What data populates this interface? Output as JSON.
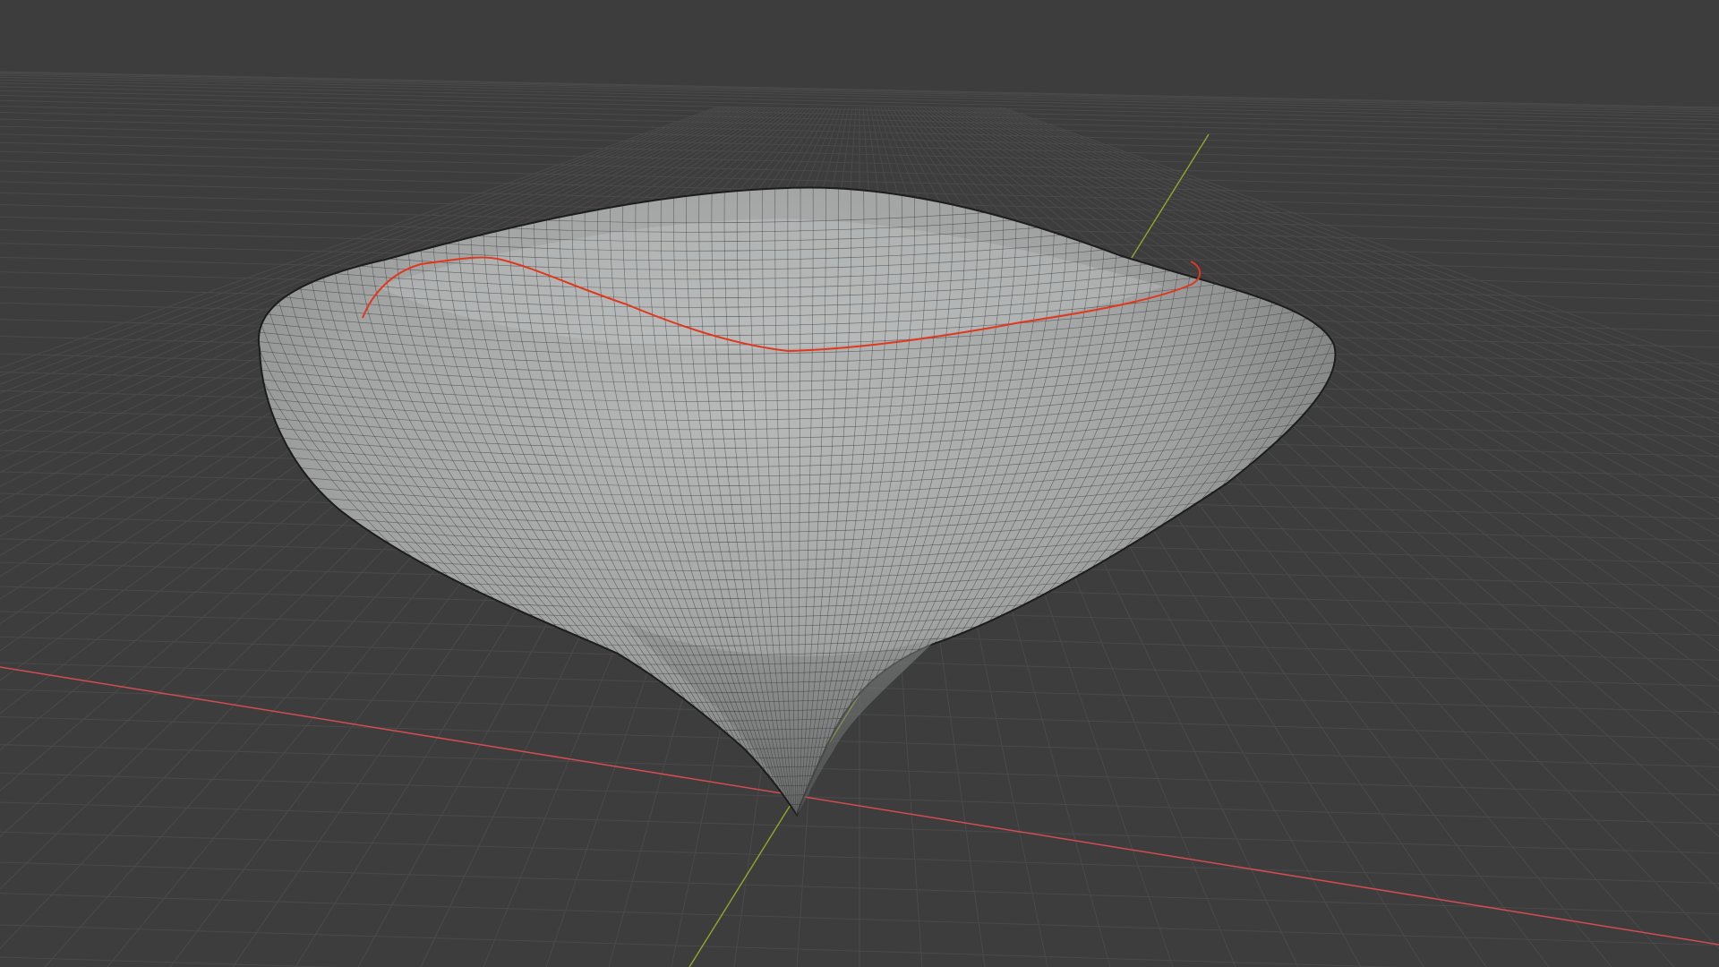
{
  "viewport": {
    "shading": "solid",
    "overlays": {
      "floor_grid": true,
      "x_axis_line": true,
      "y_axis_line": true,
      "wireframe": true
    },
    "colors": {
      "background": "#3d3d3d",
      "grid": "#4a4a4a",
      "x_axis": "#d24c52",
      "y_axis": "#8fa92a",
      "mesh": "#9c9e9e",
      "wire": "#2a2a2a",
      "seam": "#e0381e"
    }
  },
  "scene": {
    "object": "sculpted-mesh",
    "marked_seam": true
  }
}
